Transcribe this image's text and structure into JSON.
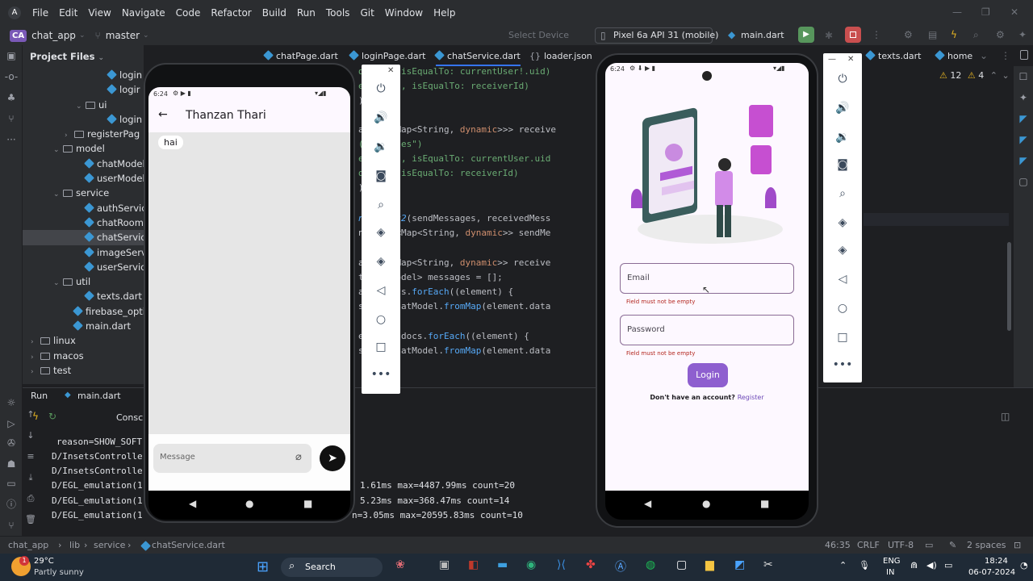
{
  "menu": [
    "File",
    "Edit",
    "View",
    "Navigate",
    "Code",
    "Refactor",
    "Build",
    "Run",
    "Tools",
    "Git",
    "Window",
    "Help"
  ],
  "toolbar": {
    "project_badge": "CA",
    "project": "chat_app",
    "branch": "master",
    "select_device": "Select Device",
    "device": "Pixel 6a API 31 (mobile)",
    "run_config": "main.dart"
  },
  "project_panel": {
    "title": "Project Files",
    "items": [
      {
        "label": "login",
        "indent": 7,
        "type": "dart",
        "arrow": ""
      },
      {
        "label": "logir",
        "indent": 7,
        "type": "dart",
        "arrow": ""
      },
      {
        "label": "ui",
        "indent": 5,
        "type": "folder",
        "arrow": "⌄"
      },
      {
        "label": "login",
        "indent": 7,
        "type": "dart",
        "arrow": ""
      },
      {
        "label": "registerPag",
        "indent": 4,
        "type": "folder",
        "arrow": "›"
      },
      {
        "label": "model",
        "indent": 3,
        "type": "folder",
        "arrow": "⌄"
      },
      {
        "label": "chatModel",
        "indent": 5,
        "type": "dart",
        "arrow": ""
      },
      {
        "label": "userModel",
        "indent": 5,
        "type": "dart",
        "arrow": ""
      },
      {
        "label": "service",
        "indent": 3,
        "type": "folder",
        "arrow": "⌄"
      },
      {
        "label": "authServic",
        "indent": 5,
        "type": "dart",
        "arrow": ""
      },
      {
        "label": "chatRoomS",
        "indent": 5,
        "type": "dart",
        "arrow": ""
      },
      {
        "label": "chatServic",
        "indent": 5,
        "type": "dart",
        "arrow": "",
        "selected": true
      },
      {
        "label": "imageServ",
        "indent": 5,
        "type": "dart",
        "arrow": ""
      },
      {
        "label": "userServic",
        "indent": 5,
        "type": "dart",
        "arrow": ""
      },
      {
        "label": "util",
        "indent": 3,
        "type": "folder",
        "arrow": "⌄"
      },
      {
        "label": "texts.dart",
        "indent": 5,
        "type": "dart",
        "arrow": ""
      },
      {
        "label": "firebase_optic",
        "indent": 4,
        "type": "dart",
        "arrow": ""
      },
      {
        "label": "main.dart",
        "indent": 4,
        "type": "dart",
        "arrow": ""
      },
      {
        "label": "linux",
        "indent": 1,
        "type": "folder",
        "arrow": "›"
      },
      {
        "label": "macos",
        "indent": 1,
        "type": "folder",
        "arrow": "›"
      },
      {
        "label": "test",
        "indent": 1,
        "type": "folder",
        "arrow": "›"
      }
    ]
  },
  "tabs": {
    "t1": "chatPage.dart",
    "t2": "loginPage.dart",
    "t3": "chatService.dart",
    "t4": "loader.json",
    "t5": "texts.dart",
    "t6": "home"
  },
  "inspections": {
    "warnings": "12",
    "weak": "4"
  },
  "code": {
    "l1": "derId\", isEqualTo: currentUser!.uid)",
    "l2a": "eiverId\", isEqualTo: receiverId)",
    "l3": ");",
    "l4a": "apshot<Map<String, ",
    "l4b": "dynamic",
    "l4c": ">>> receive",
    "l5": "(\"Messages\")",
    "l6": "eiverId\", isEqualTo: currentUser.uid",
    "l7": "derId\", isEqualTo: receiverId)",
    "l8": ");",
    "l9a": "neLatest2",
    "l9b": "(sendMessages, receivedMess",
    "l10a": "napshot<Map<String, ",
    "l10b": "dynamic",
    "l10c": ">> sendMe",
    "l11a": "apshot<Map<String, ",
    "l11b": "dynamic",
    "l11c": ">> receive",
    "l12": "t<ChatModel> messages = [];",
    "l13a": "ages.docs.",
    "l13b": "forEach",
    "l13c": "((element) {",
    "l14a": "s.add(ChatModel.",
    "l14b": "fromMap",
    "l14c": "(element.data",
    "l15a": "essages.docs.",
    "l15b": "forEach",
    "l15c": "((element) {",
    "l16a": "s.add(ChatModel.",
    "l16b": "fromMap",
    "l16c": "(element.data"
  },
  "run_panel": {
    "run_label": "Run",
    "run_tab": "main.dart",
    "console_tab": "Consc",
    "lines": [
      "reason=SHOW_SOFT",
      "D/InsetsControlle",
      "D/InsetsControlle",
      "D/EGL_emulation(1",
      "D/EGL_emulation(1",
      "D/EGL_emulation(1"
    ],
    "right_lines": [
      "1.61ms max=4487.99ms count=20",
      "5.23ms max=368.47ms count=14",
      "n=3.05ms max=20595.83ms count=10"
    ]
  },
  "phone1": {
    "time": "6:24",
    "contact": "Thanzan Thari",
    "messages": [
      "hai"
    ],
    "message_placeholder": "Message"
  },
  "phone2": {
    "time": "6:24",
    "email_label": "Email",
    "email_error": "Field must not be empty",
    "password_label": "Password",
    "password_error": "Field must not be empty",
    "login_button": "Login",
    "no_account": "Don't have an account? ",
    "register": "Register"
  },
  "statusbar": {
    "crumb1": "chat_app",
    "crumb2": "lib",
    "crumb3": "service",
    "crumb4": "chatService.dart",
    "position": "46:35",
    "line_sep": "CRLF",
    "encoding": "UTF-8",
    "indent": "2 spaces"
  },
  "taskbar": {
    "temp": "29°C",
    "weather": "Partly sunny",
    "search": "Search",
    "lang1": "ENG",
    "lang2": "IN",
    "time": "18:24",
    "date": "06-07-2024",
    "notif_count": "1"
  },
  "colors": {
    "accent": "#3574f0",
    "login_purple": "#8e5fcf",
    "error_red": "#b3261e",
    "register_purple": "#6e4ab8"
  }
}
